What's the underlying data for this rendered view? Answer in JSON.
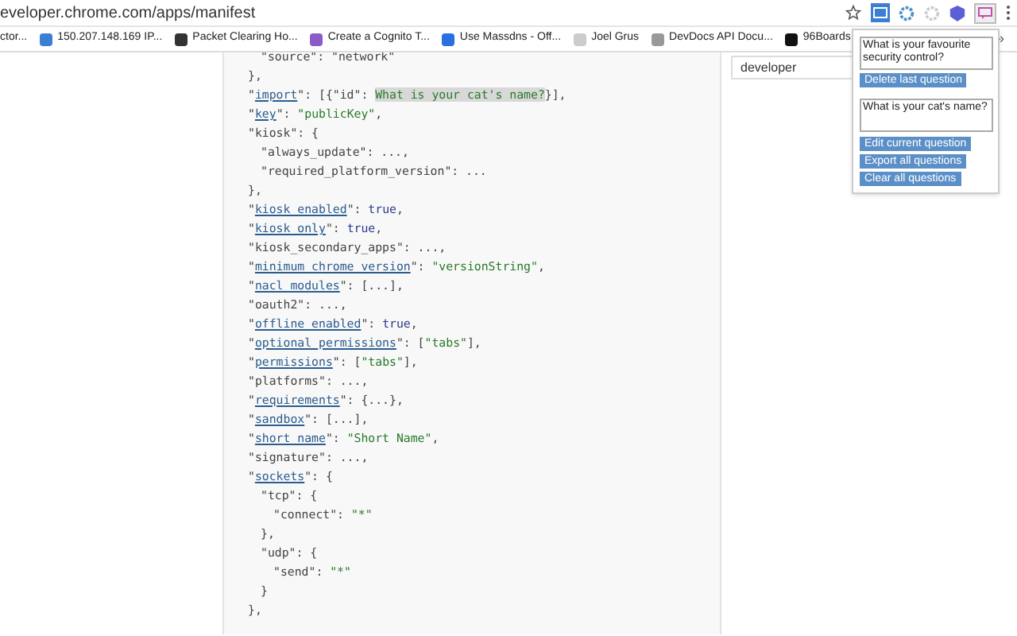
{
  "address_bar": {
    "url": "eveloper.chrome.com/apps/manifest"
  },
  "bookmarks": [
    {
      "label": "ctor..."
    },
    {
      "label": "150.207.148.169 IP..."
    },
    {
      "label": "Packet Clearing Ho..."
    },
    {
      "label": "Create a Cognito T..."
    },
    {
      "label": "Use Massdns - Off..."
    },
    {
      "label": "Joel Grus"
    },
    {
      "label": "DevDocs API Docu..."
    },
    {
      "label": "96Boards"
    }
  ],
  "bookmarks_overflow": "»",
  "find_field": {
    "value": "developer"
  },
  "popup": {
    "question_1": "What is your favourite security control?",
    "delete_button": "Delete last question",
    "question_2": "What is your cat's name?",
    "buttons": [
      "Edit current question",
      "Export all questions",
      "Clear all questions"
    ]
  },
  "code_lines": [
    {
      "children": [
        {
          "parts": [
            {
              "kind": "plain",
              "text": "\"source\": \"network\""
            }
          ]
        }
      ]
    },
    {
      "parts": [
        {
          "kind": "plain",
          "text": "},"
        }
      ]
    },
    {
      "parts": [
        {
          "kind": "plain",
          "text": "\""
        },
        {
          "kind": "link",
          "text": "import"
        },
        {
          "kind": "plain",
          "text": "\": [{\"id\": "
        },
        {
          "kind": "highlight",
          "text": "What is your cat's name?"
        },
        {
          "kind": "plain",
          "text": "}],"
        }
      ]
    },
    {
      "parts": [
        {
          "kind": "plain",
          "text": "\""
        },
        {
          "kind": "link",
          "text": "key"
        },
        {
          "kind": "plain",
          "text": "\": "
        },
        {
          "kind": "string",
          "text": "\"publicKey\""
        },
        {
          "kind": "plain",
          "text": ","
        }
      ]
    },
    {
      "parts": [
        {
          "kind": "plain",
          "text": "\"kiosk\": {"
        }
      ],
      "children": [
        {
          "parts": [
            {
              "kind": "plain",
              "text": "\"always_update\": ...,"
            }
          ]
        },
        {
          "parts": [
            {
              "kind": "plain",
              "text": "\"required_platform_version\": ..."
            }
          ]
        }
      ]
    },
    {
      "parts": [
        {
          "kind": "plain",
          "text": "},"
        }
      ]
    },
    {
      "parts": [
        {
          "kind": "plain",
          "text": "\""
        },
        {
          "kind": "link",
          "text": "kiosk_enabled"
        },
        {
          "kind": "plain",
          "text": "\": "
        },
        {
          "kind": "literal",
          "text": "true"
        },
        {
          "kind": "plain",
          "text": ","
        }
      ]
    },
    {
      "parts": [
        {
          "kind": "plain",
          "text": "\""
        },
        {
          "kind": "link",
          "text": "kiosk_only"
        },
        {
          "kind": "plain",
          "text": "\": "
        },
        {
          "kind": "literal",
          "text": "true"
        },
        {
          "kind": "plain",
          "text": ","
        }
      ]
    },
    {
      "parts": [
        {
          "kind": "plain",
          "text": "\"kiosk_secondary_apps\": ...,"
        }
      ]
    },
    {
      "parts": [
        {
          "kind": "plain",
          "text": "\""
        },
        {
          "kind": "link",
          "text": "minimum_chrome_version"
        },
        {
          "kind": "plain",
          "text": "\": "
        },
        {
          "kind": "string",
          "text": "\"versionString\""
        },
        {
          "kind": "plain",
          "text": ","
        }
      ]
    },
    {
      "parts": [
        {
          "kind": "plain",
          "text": "\""
        },
        {
          "kind": "link",
          "text": "nacl_modules"
        },
        {
          "kind": "plain",
          "text": "\": [...],"
        }
      ]
    },
    {
      "parts": [
        {
          "kind": "plain",
          "text": "\"oauth2\": ...,"
        }
      ]
    },
    {
      "parts": [
        {
          "kind": "plain",
          "text": "\""
        },
        {
          "kind": "link",
          "text": "offline_enabled"
        },
        {
          "kind": "plain",
          "text": "\": "
        },
        {
          "kind": "literal",
          "text": "true"
        },
        {
          "kind": "plain",
          "text": ","
        }
      ]
    },
    {
      "parts": [
        {
          "kind": "plain",
          "text": "\""
        },
        {
          "kind": "link",
          "text": "optional_permissions"
        },
        {
          "kind": "plain",
          "text": "\": ["
        },
        {
          "kind": "string",
          "text": "\"tabs\""
        },
        {
          "kind": "plain",
          "text": "],"
        }
      ]
    },
    {
      "parts": [
        {
          "kind": "plain",
          "text": "\""
        },
        {
          "kind": "link",
          "text": "permissions"
        },
        {
          "kind": "plain",
          "text": "\": ["
        },
        {
          "kind": "string",
          "text": "\"tabs\""
        },
        {
          "kind": "plain",
          "text": "],"
        }
      ]
    },
    {
      "parts": [
        {
          "kind": "plain",
          "text": "\"platforms\": ...,"
        }
      ]
    },
    {
      "parts": [
        {
          "kind": "plain",
          "text": "\""
        },
        {
          "kind": "link",
          "text": "requirements"
        },
        {
          "kind": "plain",
          "text": "\": {...},"
        }
      ]
    },
    {
      "parts": [
        {
          "kind": "plain",
          "text": "\""
        },
        {
          "kind": "link",
          "text": "sandbox"
        },
        {
          "kind": "plain",
          "text": "\": [...],"
        }
      ]
    },
    {
      "parts": [
        {
          "kind": "plain",
          "text": "\""
        },
        {
          "kind": "link",
          "text": "short_name"
        },
        {
          "kind": "plain",
          "text": "\": "
        },
        {
          "kind": "string",
          "text": "\"Short Name\""
        },
        {
          "kind": "plain",
          "text": ","
        }
      ]
    },
    {
      "parts": [
        {
          "kind": "plain",
          "text": "\"signature\": ...,"
        }
      ]
    },
    {
      "parts": [
        {
          "kind": "plain",
          "text": "\""
        },
        {
          "kind": "link",
          "text": "sockets"
        },
        {
          "kind": "plain",
          "text": "\": {"
        }
      ],
      "children": [
        {
          "parts": [
            {
              "kind": "plain",
              "text": "\"tcp\": {"
            }
          ],
          "children": [
            {
              "parts": [
                {
                  "kind": "plain",
                  "text": "\"connect\": "
                },
                {
                  "kind": "string",
                  "text": "\"*\""
                }
              ]
            }
          ]
        },
        {
          "parts": [
            {
              "kind": "plain",
              "text": "},"
            }
          ]
        },
        {
          "parts": [
            {
              "kind": "plain",
              "text": "\"udp\": {"
            }
          ],
          "children": [
            {
              "parts": [
                {
                  "kind": "plain",
                  "text": "\"send\": "
                },
                {
                  "kind": "string",
                  "text": "\"*\""
                }
              ]
            }
          ]
        },
        {
          "parts": [
            {
              "kind": "plain",
              "text": "}"
            }
          ]
        }
      ]
    },
    {
      "parts": [
        {
          "kind": "plain",
          "text": "},"
        }
      ]
    }
  ]
}
